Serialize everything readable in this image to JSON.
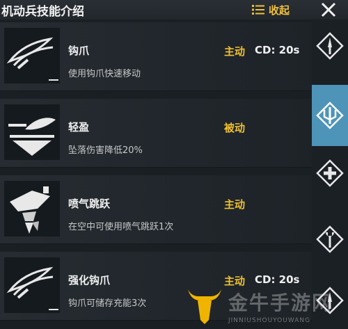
{
  "header": {
    "title": "机动兵技能介绍",
    "collapse_label": "收起"
  },
  "skills": [
    {
      "name": "钩爪",
      "desc": "使用钩爪快速移动",
      "type": "主动",
      "cd": "CD: 20s",
      "icon": "grapple-claw-icon"
    },
    {
      "name": "轻盈",
      "desc": "坠落伤害降低20%",
      "type": "被动",
      "cd": "",
      "icon": "feather-icon"
    },
    {
      "name": "喷气跳跃",
      "desc": "在空中可使用喷气跳跃1次",
      "type": "主动",
      "cd": "",
      "icon": "jetpack-icon"
    },
    {
      "name": "强化钩爪",
      "desc": "钩爪可储存充能3次",
      "type": "主动",
      "cd": "CD: 20s",
      "icon": "grapple-claw-icon"
    }
  ],
  "rail": [
    "dagger-icon",
    "trident-icon",
    "health-plus-icon",
    "wrench-icon",
    "dagger-icon"
  ],
  "watermark": {
    "name": "金牛手游网",
    "sub": "JINNIUSHOUYOUWANG"
  },
  "colors": {
    "accent_active": "#4d94b8",
    "active_type": "#f0c030"
  }
}
